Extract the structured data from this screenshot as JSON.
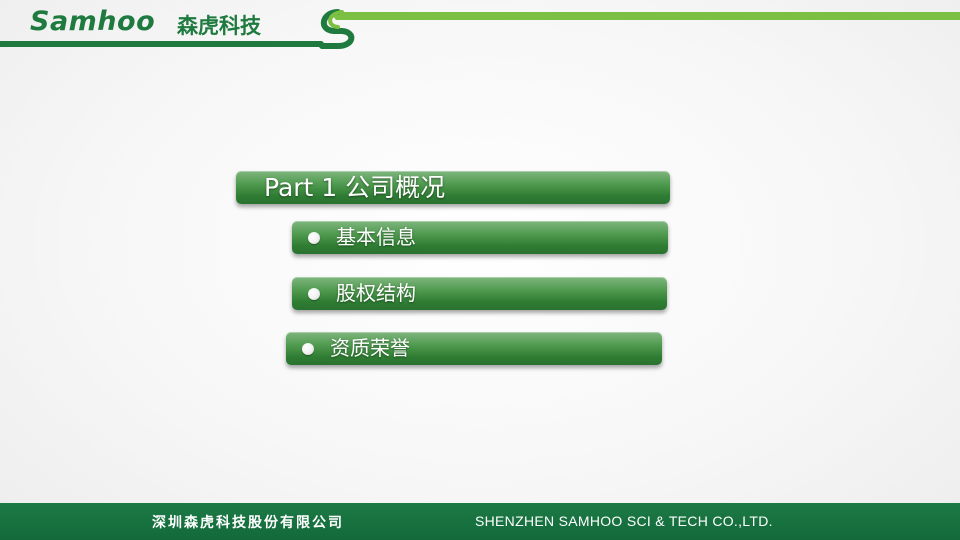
{
  "header": {
    "logo_text": "Samhoo",
    "logo_cn": "森虎科技",
    "accent_color": "#1e7a3e",
    "stripe_color": "#7cc043",
    "logo_mark_icon": "s-swoosh-icon"
  },
  "menu": {
    "title": "Part  1 公司概况",
    "items": [
      {
        "label": "基本信息"
      },
      {
        "label": "股权结构"
      },
      {
        "label": "资质荣誉"
      }
    ],
    "bar_color": "#3f8d42",
    "bullet_icon": "white-dot-icon"
  },
  "footer": {
    "company_cn": "深圳森虎科技股份有限公司",
    "company_en": "SHENZHEN SAMHOO SCI & TECH CO.,LTD.",
    "background_color": "#17703e"
  }
}
